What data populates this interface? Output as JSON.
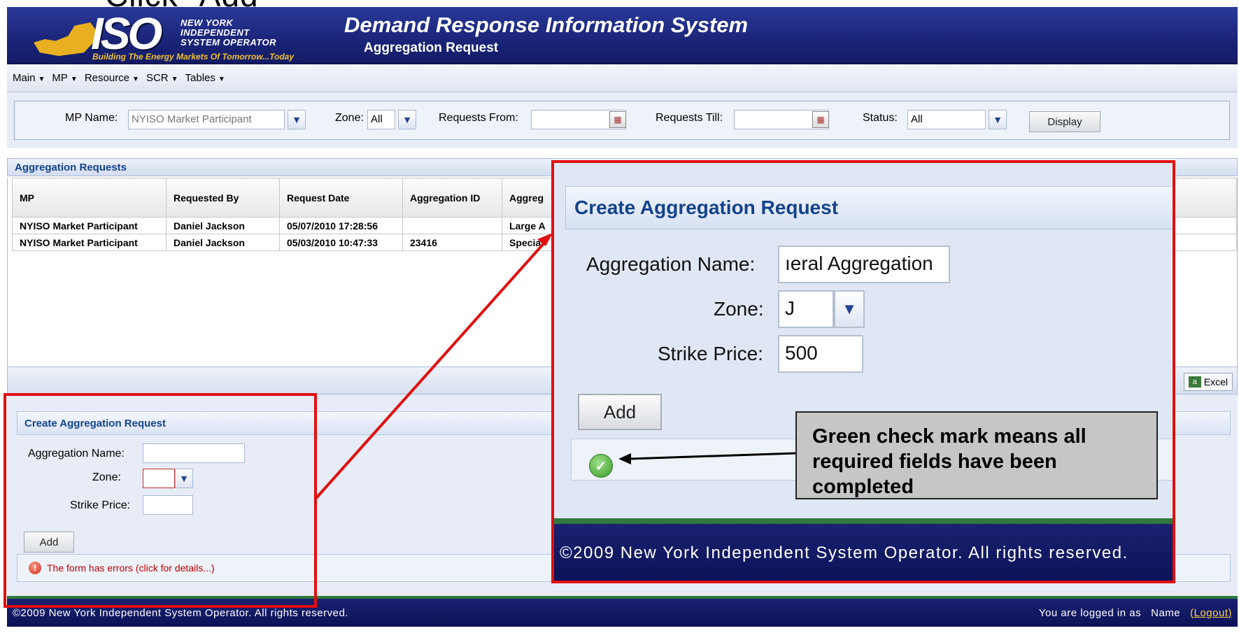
{
  "slide": {
    "title": "Click “Add”"
  },
  "header": {
    "logo_iso": "ISO",
    "logo_company": [
      "NEW YORK",
      "INDEPENDENT",
      "SYSTEM OPERATOR"
    ],
    "logo_tagline": "Building The Energy Markets Of Tomorrow...Today",
    "app_title": "Demand Response Information System",
    "page_subtitle": "Aggregation Request",
    "brand_color": "#1a2478"
  },
  "menu": {
    "items": [
      {
        "label": "Main"
      },
      {
        "label": "MP"
      },
      {
        "label": "Resource"
      },
      {
        "label": "SCR"
      },
      {
        "label": "Tables"
      }
    ]
  },
  "filters": {
    "mp_name_label": "MP Name:",
    "mp_name_value": "NYISO Market Participant",
    "zone_label": "Zone:",
    "zone_value": "All",
    "requests_from_label": "Requests From:",
    "requests_from_value": "",
    "requests_till_label": "Requests Till:",
    "requests_till_value": "",
    "status_label": "Status:",
    "status_value": "All",
    "display_button": "Display"
  },
  "grid": {
    "title": "Aggregation Requests",
    "columns": [
      "MP",
      "Requested By",
      "Request Date",
      "Aggregation ID",
      "Aggreg"
    ],
    "rows": [
      [
        "NYISO Market Participant",
        "Daniel Jackson",
        "05/07/2010 17:28:56",
        "",
        "Large A"
      ],
      [
        "NYISO Market Participant",
        "Daniel Jackson",
        "05/03/2010 10:47:33",
        "23416",
        "Special"
      ]
    ],
    "excel_button": "Excel"
  },
  "create_form": {
    "title": "Create Aggregation Request",
    "name_label": "Aggregation Name:",
    "name_value": "",
    "zone_label": "Zone:",
    "zone_value": "",
    "strike_label": "Strike Price:",
    "strike_value": "",
    "add_button": "Add",
    "error_message": "The form has errors (click for details...)"
  },
  "zoom_form": {
    "title": "Create Aggregation Request",
    "name_label": "Aggregation Name:",
    "name_value": "ıeral Aggregation",
    "zone_label": "Zone:",
    "zone_value": "J",
    "strike_label": "Strike Price:",
    "strike_value": "500",
    "add_button": "Add",
    "footer": "©2009    New York Independent System Operator. All rights reserved."
  },
  "annotation": {
    "text": "Green check mark means all required fields have been completed"
  },
  "footer": {
    "copyright": "©2009    New York Independent System Operator. All rights reserved.",
    "logged_in_label": "You are logged in as",
    "user_name": "Name",
    "logout_label": "(Logout)"
  },
  "icons": [
    "dropdown-arrow-icon",
    "calendar-icon",
    "excel-icon",
    "error-icon",
    "green-check-icon"
  ]
}
